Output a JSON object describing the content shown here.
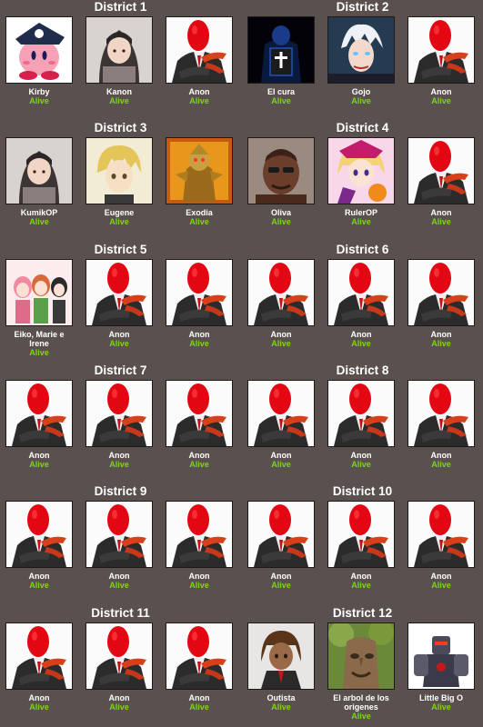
{
  "colors": {
    "background": "#5a514e",
    "alive": "#7ed321",
    "title": "#ffffff"
  },
  "districts": [
    {
      "title": "District 1",
      "tributes": [
        {
          "name": "Kirby",
          "status": "Alive",
          "portrait": "kirby-portrait"
        },
        {
          "name": "Kanon",
          "status": "Alive",
          "portrait": "anime-girl-portrait"
        },
        {
          "name": "Anon",
          "status": "Alive",
          "portrait": "anon-placeholder-icon"
        }
      ]
    },
    {
      "title": "District 2",
      "tributes": [
        {
          "name": "El cura",
          "status": "Alive",
          "portrait": "priest-bible-portrait"
        },
        {
          "name": "Gojo",
          "status": "Alive",
          "portrait": "gojo-portrait"
        },
        {
          "name": "Anon",
          "status": "Alive",
          "portrait": "anon-placeholder-icon"
        }
      ]
    },
    {
      "title": "District 3",
      "tributes": [
        {
          "name": "KumikOP",
          "status": "Alive",
          "portrait": "anime-girl-portrait"
        },
        {
          "name": "Eugene",
          "status": "Alive",
          "portrait": "blonde-boy-portrait"
        },
        {
          "name": "Exodia",
          "status": "Alive",
          "portrait": "exodia-portrait"
        }
      ]
    },
    {
      "title": "District 4",
      "tributes": [
        {
          "name": "Oliva",
          "status": "Alive",
          "portrait": "oliva-portrait"
        },
        {
          "name": "RulerOP",
          "status": "Alive",
          "portrait": "pink-girl-portrait"
        },
        {
          "name": "Anon",
          "status": "Alive",
          "portrait": "anon-placeholder-icon"
        }
      ]
    },
    {
      "title": "District 5",
      "tributes": [
        {
          "name": "Eiko, Marie e Irene",
          "status": "Alive",
          "portrait": "three-girls-portrait"
        },
        {
          "name": "Anon",
          "status": "Alive",
          "portrait": "anon-placeholder-icon"
        },
        {
          "name": "Anon",
          "status": "Alive",
          "portrait": "anon-placeholder-icon"
        }
      ]
    },
    {
      "title": "District 6",
      "tributes": [
        {
          "name": "Anon",
          "status": "Alive",
          "portrait": "anon-placeholder-icon"
        },
        {
          "name": "Anon",
          "status": "Alive",
          "portrait": "anon-placeholder-icon"
        },
        {
          "name": "Anon",
          "status": "Alive",
          "portrait": "anon-placeholder-icon"
        }
      ]
    },
    {
      "title": "District 7",
      "tributes": [
        {
          "name": "Anon",
          "status": "Alive",
          "portrait": "anon-placeholder-icon"
        },
        {
          "name": "Anon",
          "status": "Alive",
          "portrait": "anon-placeholder-icon"
        },
        {
          "name": "Anon",
          "status": "Alive",
          "portrait": "anon-placeholder-icon"
        }
      ]
    },
    {
      "title": "District 8",
      "tributes": [
        {
          "name": "Anon",
          "status": "Alive",
          "portrait": "anon-placeholder-icon"
        },
        {
          "name": "Anon",
          "status": "Alive",
          "portrait": "anon-placeholder-icon"
        },
        {
          "name": "Anon",
          "status": "Alive",
          "portrait": "anon-placeholder-icon"
        }
      ]
    },
    {
      "title": "District 9",
      "tributes": [
        {
          "name": "Anon",
          "status": "Alive",
          "portrait": "anon-placeholder-icon"
        },
        {
          "name": "Anon",
          "status": "Alive",
          "portrait": "anon-placeholder-icon"
        },
        {
          "name": "Anon",
          "status": "Alive",
          "portrait": "anon-placeholder-icon"
        }
      ]
    },
    {
      "title": "District 10",
      "tributes": [
        {
          "name": "Anon",
          "status": "Alive",
          "portrait": "anon-placeholder-icon"
        },
        {
          "name": "Anon",
          "status": "Alive",
          "portrait": "anon-placeholder-icon"
        },
        {
          "name": "Anon",
          "status": "Alive",
          "portrait": "anon-placeholder-icon"
        }
      ]
    },
    {
      "title": "District 11",
      "tributes": [
        {
          "name": "Anon",
          "status": "Alive",
          "portrait": "anon-placeholder-icon"
        },
        {
          "name": "Anon",
          "status": "Alive",
          "portrait": "anon-placeholder-icon"
        },
        {
          "name": "Anon",
          "status": "Alive",
          "portrait": "anon-placeholder-icon"
        }
      ]
    },
    {
      "title": "District 12",
      "tributes": [
        {
          "name": "Outista",
          "status": "Alive",
          "portrait": "anime-boy-portrait"
        },
        {
          "name": "El arbol de los origenes",
          "status": "Alive",
          "portrait": "tree-face-portrait"
        },
        {
          "name": "Little Big O",
          "status": "Alive",
          "portrait": "robot-portrait"
        }
      ]
    }
  ]
}
